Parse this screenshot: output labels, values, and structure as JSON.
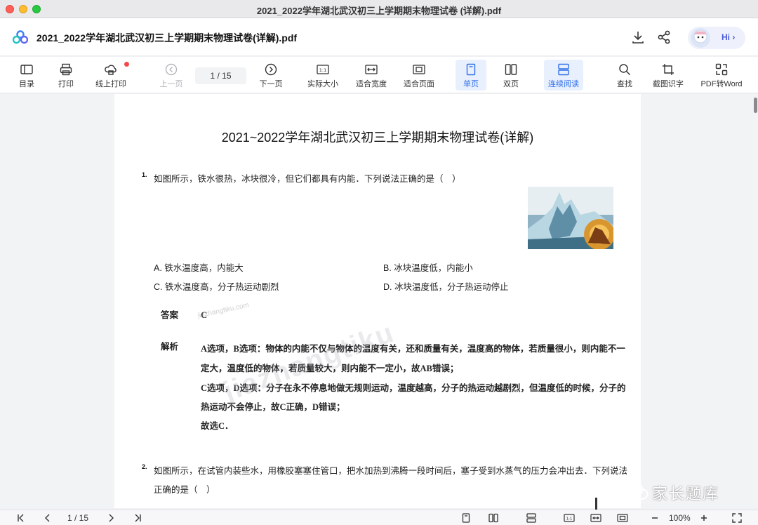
{
  "window": {
    "title": "2021_2022学年湖北武汉初三上学期期末物理试卷 (详解).pdf"
  },
  "header": {
    "doc_title": "2021_2022学年湖北武汉初三上学期期末物理试卷(详解).pdf",
    "hi_label": "Hi",
    "hi_chevron": "›"
  },
  "toolbar": {
    "toc": "目录",
    "print": "打印",
    "online_print": "线上打印",
    "prev_page": "上一页",
    "page_indicator": "1   / 15",
    "next_page": "下一页",
    "actual_size": "实际大小",
    "fit_width": "适合宽度",
    "fit_page": "适合页面",
    "single_page": "单页",
    "double_page": "双页",
    "continuous": "连续阅读",
    "search": "查找",
    "ocr": "截图识字",
    "pdf_to_word": "PDF转Word"
  },
  "document": {
    "title": "2021~2022学年湖北武汉初三上学期期末物理试卷(详解)",
    "q1": {
      "num": "1.",
      "text": "如图所示，铁水很热，冰块很冷，但它们都具有内能．下列说法正确的是（　）",
      "options": {
        "a": "A. 铁水温度高，内能大",
        "b": "B. 冰块温度低，内能小",
        "c": "C. 铁水温度高，分子热运动剧烈",
        "d": "D. 冰块温度低，分子热运动停止"
      },
      "answer_label": "答案",
      "answer": "C",
      "analysis_label": "解析",
      "analysis": [
        "A选项，B选项：物体的内能不仅与物体的温度有关，还和质量有关，温度高的物体，若质量很小，则内能不一",
        "定大，温度低的物体，若质量较大，则内能不一定小，故AB错误；",
        "C选项，D选项：分子在永不停息地做无规则运动，温度越高，分子的热运动越剧烈，但温度低的时候，分子的",
        "热运动不会停止，故C正确，D错误；",
        "故选C．"
      ]
    },
    "q2": {
      "num": "2.",
      "line1": "如图所示，在试管内装些水，用橡胶塞塞住管口，把水加热到沸腾一段时间后，塞子受到水蒸气的压力会冲出去．下列说法",
      "line2": "正确的是（　）"
    },
    "watermark": "jiazhangtiku",
    "watermark_small": "jiazhangtiku.com"
  },
  "bottom": {
    "page_indicator": "1   / 15",
    "zoom": "100%"
  },
  "brand": {
    "text": "家长题库"
  },
  "colors": {
    "accent": "#2f6fe8",
    "active_bg": "#e8f0fe",
    "notify": "#f24a4a"
  }
}
